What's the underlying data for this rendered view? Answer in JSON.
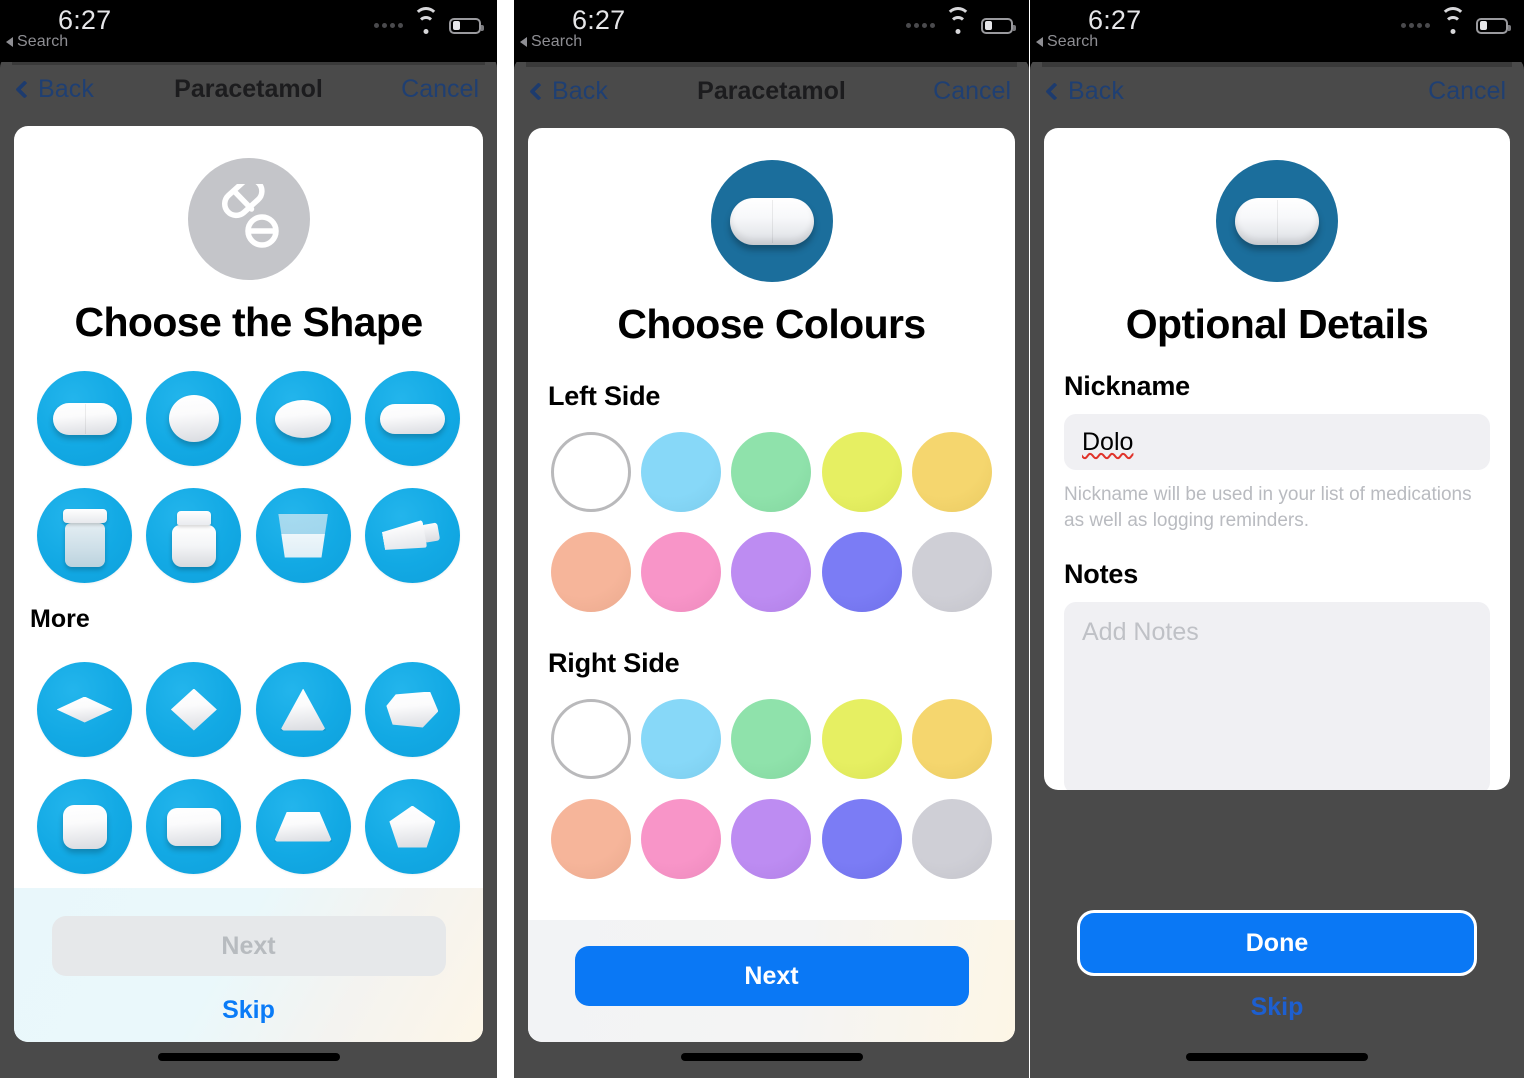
{
  "status_bar": {
    "time": "6:27",
    "back_label": "Search",
    "wifi_icon": "wifi-icon",
    "battery_icon": "battery-low-icon",
    "signal_icon": "signal-dots-icon"
  },
  "screens": [
    {
      "id": "choose-shape",
      "nav": {
        "back_label": "Back",
        "title": "Paracetamol",
        "cancel_label": "Cancel"
      },
      "hero": {
        "icon": "pills-outline-icon",
        "title": "Choose the Shape",
        "circle_color": "#c4c5c9"
      },
      "shapes_primary": [
        {
          "name": "capsule",
          "label": "Capsule"
        },
        {
          "name": "round",
          "label": "Round"
        },
        {
          "name": "oval",
          "label": "Oval"
        },
        {
          "name": "oblong",
          "label": "Oblong"
        },
        {
          "name": "bottle",
          "label": "Bottle"
        },
        {
          "name": "jar",
          "label": "Jar"
        },
        {
          "name": "cup",
          "label": "Cup"
        },
        {
          "name": "tube",
          "label": "Tube"
        }
      ],
      "more_label": "More",
      "shapes_more": [
        {
          "name": "diamond-flat",
          "label": "Flat Diamond"
        },
        {
          "name": "diamond",
          "label": "Diamond"
        },
        {
          "name": "triangle",
          "label": "Triangle"
        },
        {
          "name": "freeform",
          "label": "Freeform"
        },
        {
          "name": "square",
          "label": "Square"
        },
        {
          "name": "rectangle",
          "label": "Rectangle"
        },
        {
          "name": "trapezoid",
          "label": "Trapezoid"
        },
        {
          "name": "pentagon",
          "label": "Pentagon"
        }
      ],
      "shape_tile_color": "#12a9e4",
      "footer": {
        "next_label": "Next",
        "next_enabled": false,
        "skip_label": "Skip"
      }
    },
    {
      "id": "choose-colours",
      "nav": {
        "back_label": "Back",
        "title": "Paracetamol",
        "cancel_label": "Cancel"
      },
      "hero": {
        "icon": "capsule-icon",
        "title": "Choose Colours",
        "circle_color": "#1b6e9c"
      },
      "left_side_label": "Left Side",
      "right_side_label": "Right Side",
      "palette": [
        {
          "name": "white",
          "hex": "#ffffff",
          "selected": true
        },
        {
          "name": "blue",
          "hex": "#87d8f8",
          "selected": false
        },
        {
          "name": "green",
          "hex": "#8fe2ab",
          "selected": false
        },
        {
          "name": "yellow",
          "hex": "#e6ef62",
          "selected": false
        },
        {
          "name": "gold",
          "hex": "#f5d66e",
          "selected": false
        },
        {
          "name": "peach",
          "hex": "#f6b59a",
          "selected": false
        },
        {
          "name": "pink",
          "hex": "#f895c8",
          "selected": false
        },
        {
          "name": "purple",
          "hex": "#bd8cf2",
          "selected": false
        },
        {
          "name": "indigo",
          "hex": "#7b7cf5",
          "selected": false
        },
        {
          "name": "grey",
          "hex": "#cfcfd6",
          "selected": false
        }
      ],
      "footer": {
        "next_label": "Next",
        "next_enabled": true
      }
    },
    {
      "id": "optional-details",
      "nav": {
        "back_label": "Back",
        "title": "",
        "cancel_label": "Cancel"
      },
      "hero": {
        "icon": "capsule-icon",
        "title": "Optional Details",
        "circle_color": "#1b6e9c"
      },
      "nickname": {
        "label": "Nickname",
        "value": "Dolo",
        "placeholder": "Nickname",
        "misspelled": true,
        "hint": "Nickname will be used in your list of medications as well as logging reminders."
      },
      "notes": {
        "label": "Notes",
        "value": "",
        "placeholder": "Add Notes"
      },
      "footer": {
        "done_label": "Done",
        "skip_label": "Skip"
      }
    }
  ],
  "colors": {
    "accent_blue": "#0a78f5",
    "tile_blue": "#12a9e4",
    "hero_blue": "#1b6e9c",
    "sheet_grey": "#4a4a4a",
    "nav_link": "#1f3f72"
  }
}
